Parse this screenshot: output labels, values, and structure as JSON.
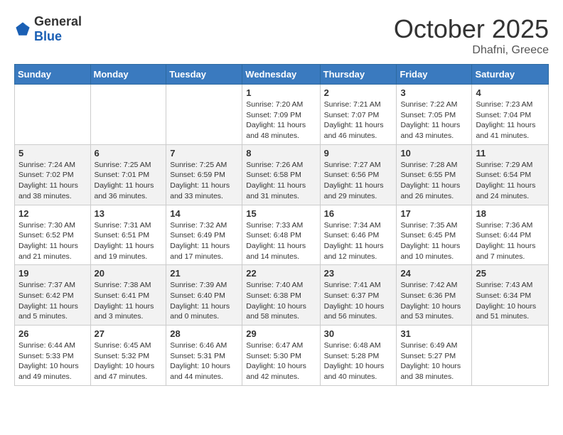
{
  "header": {
    "logo_general": "General",
    "logo_blue": "Blue",
    "month": "October 2025",
    "location": "Dhafni, Greece"
  },
  "days_of_week": [
    "Sunday",
    "Monday",
    "Tuesday",
    "Wednesday",
    "Thursday",
    "Friday",
    "Saturday"
  ],
  "weeks": [
    [
      {
        "day": "",
        "info": ""
      },
      {
        "day": "",
        "info": ""
      },
      {
        "day": "",
        "info": ""
      },
      {
        "day": "1",
        "info": "Sunrise: 7:20 AM\nSunset: 7:09 PM\nDaylight: 11 hours and 48 minutes."
      },
      {
        "day": "2",
        "info": "Sunrise: 7:21 AM\nSunset: 7:07 PM\nDaylight: 11 hours and 46 minutes."
      },
      {
        "day": "3",
        "info": "Sunrise: 7:22 AM\nSunset: 7:05 PM\nDaylight: 11 hours and 43 minutes."
      },
      {
        "day": "4",
        "info": "Sunrise: 7:23 AM\nSunset: 7:04 PM\nDaylight: 11 hours and 41 minutes."
      }
    ],
    [
      {
        "day": "5",
        "info": "Sunrise: 7:24 AM\nSunset: 7:02 PM\nDaylight: 11 hours and 38 minutes."
      },
      {
        "day": "6",
        "info": "Sunrise: 7:25 AM\nSunset: 7:01 PM\nDaylight: 11 hours and 36 minutes."
      },
      {
        "day": "7",
        "info": "Sunrise: 7:25 AM\nSunset: 6:59 PM\nDaylight: 11 hours and 33 minutes."
      },
      {
        "day": "8",
        "info": "Sunrise: 7:26 AM\nSunset: 6:58 PM\nDaylight: 11 hours and 31 minutes."
      },
      {
        "day": "9",
        "info": "Sunrise: 7:27 AM\nSunset: 6:56 PM\nDaylight: 11 hours and 29 minutes."
      },
      {
        "day": "10",
        "info": "Sunrise: 7:28 AM\nSunset: 6:55 PM\nDaylight: 11 hours and 26 minutes."
      },
      {
        "day": "11",
        "info": "Sunrise: 7:29 AM\nSunset: 6:54 PM\nDaylight: 11 hours and 24 minutes."
      }
    ],
    [
      {
        "day": "12",
        "info": "Sunrise: 7:30 AM\nSunset: 6:52 PM\nDaylight: 11 hours and 21 minutes."
      },
      {
        "day": "13",
        "info": "Sunrise: 7:31 AM\nSunset: 6:51 PM\nDaylight: 11 hours and 19 minutes."
      },
      {
        "day": "14",
        "info": "Sunrise: 7:32 AM\nSunset: 6:49 PM\nDaylight: 11 hours and 17 minutes."
      },
      {
        "day": "15",
        "info": "Sunrise: 7:33 AM\nSunset: 6:48 PM\nDaylight: 11 hours and 14 minutes."
      },
      {
        "day": "16",
        "info": "Sunrise: 7:34 AM\nSunset: 6:46 PM\nDaylight: 11 hours and 12 minutes."
      },
      {
        "day": "17",
        "info": "Sunrise: 7:35 AM\nSunset: 6:45 PM\nDaylight: 11 hours and 10 minutes."
      },
      {
        "day": "18",
        "info": "Sunrise: 7:36 AM\nSunset: 6:44 PM\nDaylight: 11 hours and 7 minutes."
      }
    ],
    [
      {
        "day": "19",
        "info": "Sunrise: 7:37 AM\nSunset: 6:42 PM\nDaylight: 11 hours and 5 minutes."
      },
      {
        "day": "20",
        "info": "Sunrise: 7:38 AM\nSunset: 6:41 PM\nDaylight: 11 hours and 3 minutes."
      },
      {
        "day": "21",
        "info": "Sunrise: 7:39 AM\nSunset: 6:40 PM\nDaylight: 11 hours and 0 minutes."
      },
      {
        "day": "22",
        "info": "Sunrise: 7:40 AM\nSunset: 6:38 PM\nDaylight: 10 hours and 58 minutes."
      },
      {
        "day": "23",
        "info": "Sunrise: 7:41 AM\nSunset: 6:37 PM\nDaylight: 10 hours and 56 minutes."
      },
      {
        "day": "24",
        "info": "Sunrise: 7:42 AM\nSunset: 6:36 PM\nDaylight: 10 hours and 53 minutes."
      },
      {
        "day": "25",
        "info": "Sunrise: 7:43 AM\nSunset: 6:34 PM\nDaylight: 10 hours and 51 minutes."
      }
    ],
    [
      {
        "day": "26",
        "info": "Sunrise: 6:44 AM\nSunset: 5:33 PM\nDaylight: 10 hours and 49 minutes."
      },
      {
        "day": "27",
        "info": "Sunrise: 6:45 AM\nSunset: 5:32 PM\nDaylight: 10 hours and 47 minutes."
      },
      {
        "day": "28",
        "info": "Sunrise: 6:46 AM\nSunset: 5:31 PM\nDaylight: 10 hours and 44 minutes."
      },
      {
        "day": "29",
        "info": "Sunrise: 6:47 AM\nSunset: 5:30 PM\nDaylight: 10 hours and 42 minutes."
      },
      {
        "day": "30",
        "info": "Sunrise: 6:48 AM\nSunset: 5:28 PM\nDaylight: 10 hours and 40 minutes."
      },
      {
        "day": "31",
        "info": "Sunrise: 6:49 AM\nSunset: 5:27 PM\nDaylight: 10 hours and 38 minutes."
      },
      {
        "day": "",
        "info": ""
      }
    ]
  ]
}
